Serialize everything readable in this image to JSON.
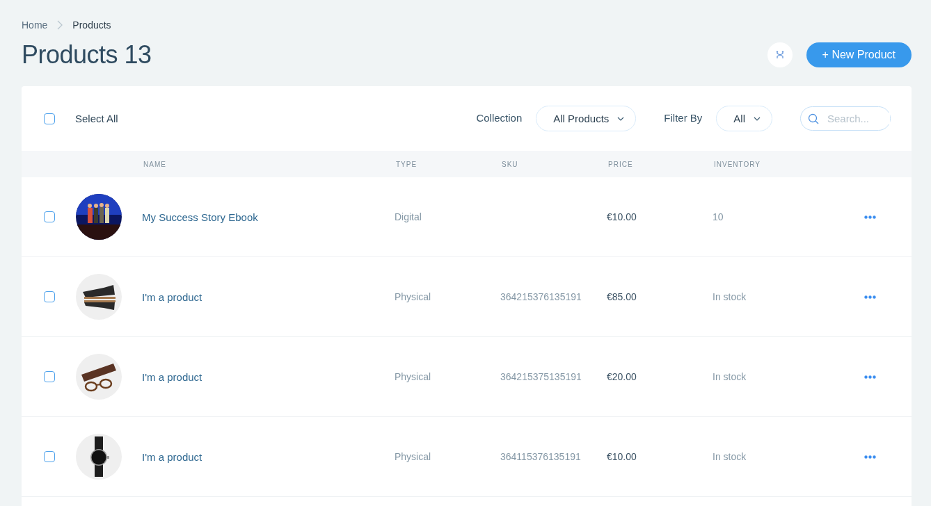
{
  "breadcrumb": [
    "Home",
    "Products"
  ],
  "title": "Products 13",
  "new_button": "+ New Product",
  "toolbar": {
    "select_all": {
      "label": "Select All",
      "checked": false
    },
    "collection_label": "Collection",
    "collection_value": "All Products",
    "filter_label": "Filter By",
    "filter_value": "All",
    "search": {
      "placeholder": "Search..."
    }
  },
  "table": {
    "columns": [
      "NAME",
      "TYPE",
      "SKU",
      "PRICE",
      "INVENTORY"
    ],
    "rows": [
      {
        "checked": false,
        "name": "My Success Story Ebook",
        "type": "Digital",
        "price": "€10.00",
        "inventory": "10"
      },
      {
        "checked": false,
        "name": "I'm a product",
        "type": "Physical",
        "sku": "364215376135191",
        "price": "€85.00",
        "inventory": "In stock"
      },
      {
        "checked": false,
        "name": "I'm a product",
        "type": "Physical",
        "sku": "364215375135191",
        "price": "€20.00",
        "inventory": "In stock"
      },
      {
        "checked": false,
        "name": "I'm a product",
        "type": "Physical",
        "sku": "364115376135191",
        "price": "€10.00",
        "inventory": "In stock"
      }
    ]
  }
}
